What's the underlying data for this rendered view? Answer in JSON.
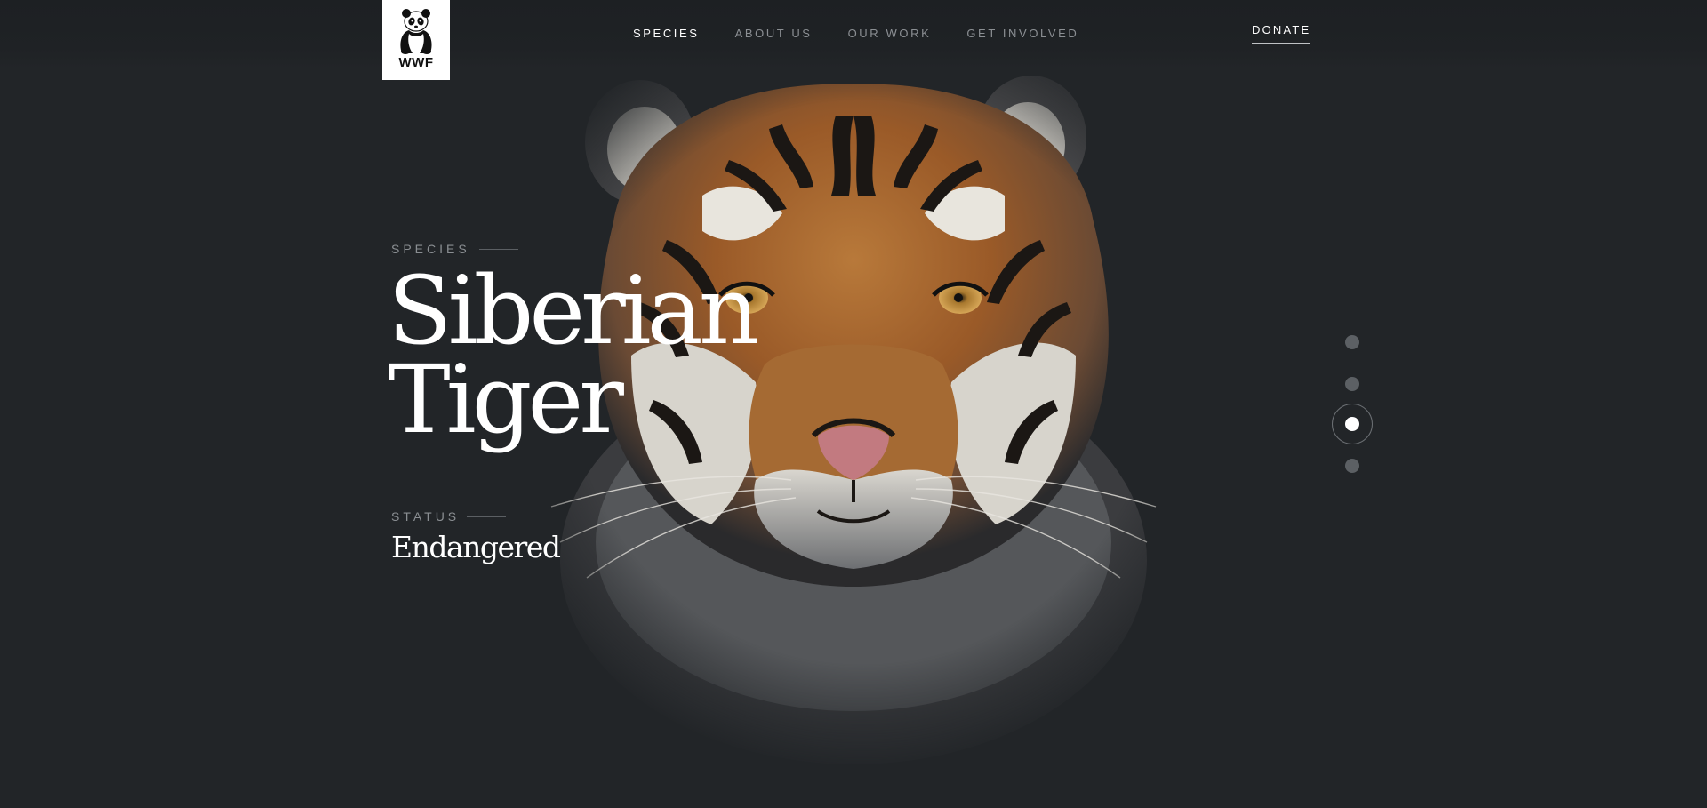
{
  "brand": {
    "name": "WWF"
  },
  "nav": {
    "items": [
      {
        "label": "SPECIES",
        "active": true
      },
      {
        "label": "ABOUT US",
        "active": false
      },
      {
        "label": "OUR WORK",
        "active": false
      },
      {
        "label": "GET INVOLVED",
        "active": false
      }
    ],
    "donate_label": "DONATE"
  },
  "hero": {
    "eyebrow": "SPECIES",
    "title_line1": "Siberian",
    "title_line2": "Tiger",
    "status_label": "STATUS",
    "status_value": "Endangered"
  },
  "pagination": {
    "count": 4,
    "active_index": 3
  },
  "colors": {
    "background": "#222528",
    "accent_text": "#ffffff",
    "muted_text": "#8b8f93"
  },
  "icons": {
    "logo": "panda-icon",
    "hero_image": "tiger-face"
  }
}
